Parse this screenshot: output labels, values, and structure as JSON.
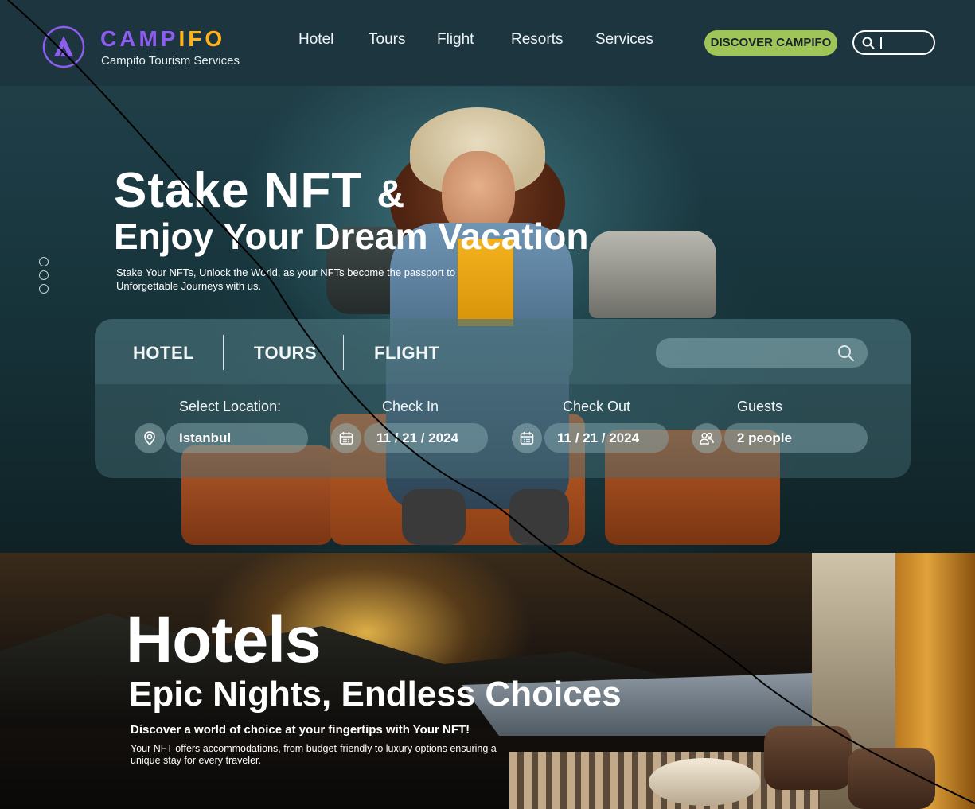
{
  "brand": {
    "name_main": "CAMP",
    "name_tail": "IFO",
    "tagline": "Campifo Tourism Services",
    "accent": "#8e5cf0",
    "accent2": "#ffb21c"
  },
  "nav": {
    "links": [
      "Hotel",
      "Tours",
      "Flight",
      "Resorts",
      "Services"
    ],
    "cta_label": "DISCOVER CAMPIFO",
    "cta_color": "#9fc458",
    "search_icon": "search-icon"
  },
  "hero": {
    "title_line1": "Stake NFT",
    "title_amp": "&",
    "title_line2": "Enjoy Your Dream Vacation",
    "description": "Stake Your NFTs, Unlock the World, as your NFTs become the passport to Unforgettable Journeys with us."
  },
  "booking": {
    "tabs": [
      "HOTEL",
      "TOURS",
      "FLIGHT"
    ],
    "search_icon": "search-icon",
    "fields": {
      "location": {
        "label": "Select Location:",
        "value": "Istanbul",
        "icon": "location-pin-icon"
      },
      "check_in": {
        "label": "Check In",
        "value": "11 / 21 / 2024",
        "icon": "calendar-icon"
      },
      "check_out": {
        "label": "Check Out",
        "value": "11 / 21 / 2024",
        "icon": "calendar-icon"
      },
      "guests": {
        "label": "Guests",
        "value": "2 people",
        "icon": "people-icon"
      }
    }
  },
  "hotels": {
    "title": "Hotels",
    "subtitle": "Epic Nights, Endless Choices",
    "lead": "Discover a world of choice at your fingertips with Your NFT!",
    "description": "Your NFT offers accommodations, from budget-friendly to luxury options ensuring a unique stay for every traveler."
  }
}
